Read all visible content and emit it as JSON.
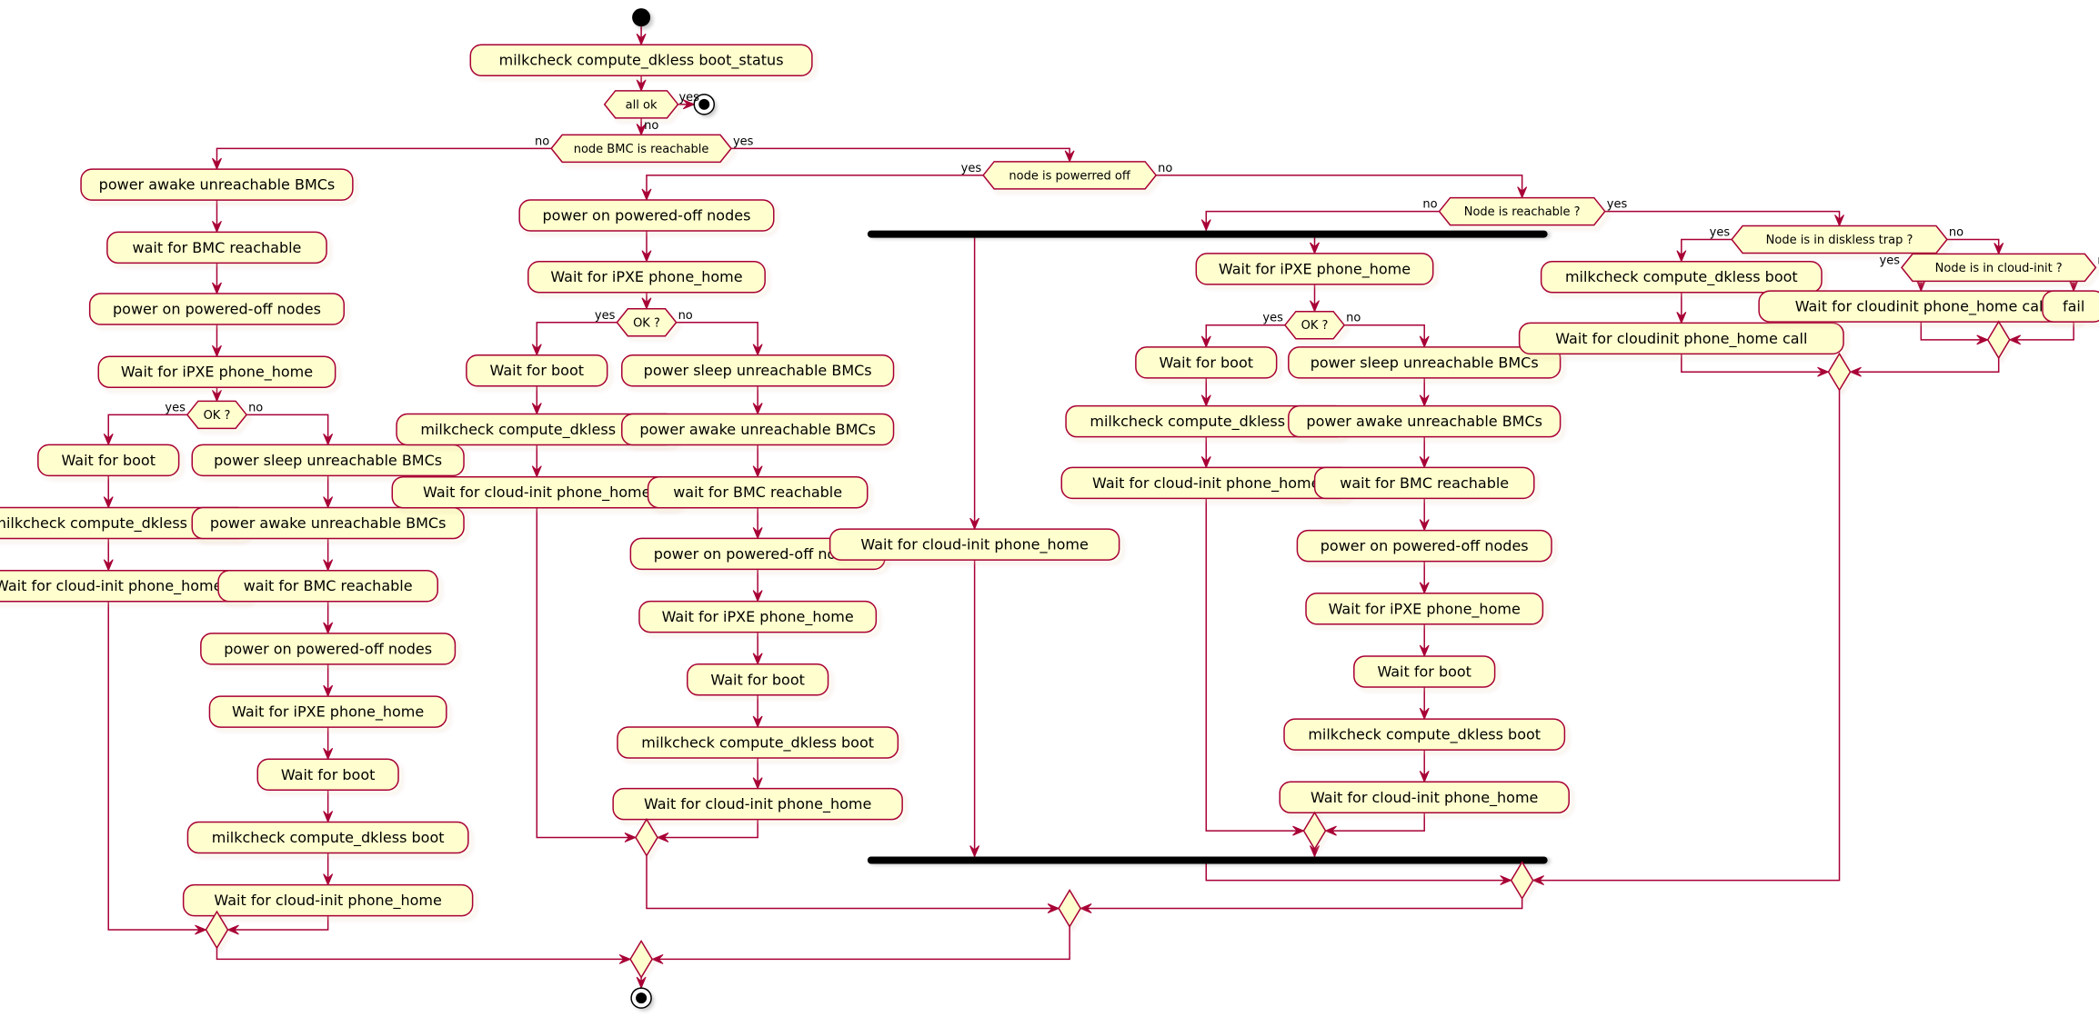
{
  "diagram": {
    "type": "activity",
    "colors": {
      "fill": "#FEFECE",
      "border": "#A80036",
      "text": "#000000",
      "bar": "#000000"
    },
    "start": "milkcheck compute_dkless boot_status",
    "nodes": {
      "boot_status": "milkcheck compute_dkless boot_status",
      "all_ok": "all ok",
      "bmc_reachable": "node BMC is reachable",
      "powered_off": "node is powerred off",
      "node_reachable": "Node is reachable ?",
      "diskless_trap": "Node is in diskless trap ?",
      "in_cloud_init": "Node is in cloud-init ?",
      "ok": "OK ?"
    },
    "labels": {
      "yes": "yes",
      "no": "no"
    },
    "branch_bmc_unreachable": {
      "pre": [
        "power awake unreachable BMCs",
        "wait for BMC reachable",
        "power on powered-off nodes",
        "Wait for iPXE phone_home"
      ],
      "ok_yes": [
        "Wait for boot",
        "milkcheck compute_dkless boot",
        "Wait for cloud-init phone_home"
      ],
      "ok_no": [
        "power sleep unreachable BMCs",
        "power awake unreachable BMCs",
        "wait for BMC reachable",
        "power on powered-off nodes",
        "Wait for iPXE phone_home",
        "Wait for boot",
        "milkcheck compute_dkless boot",
        "Wait for cloud-init phone_home"
      ]
    },
    "branch_powered_off": {
      "pre": [
        "power on powered-off nodes",
        "Wait for iPXE phone_home"
      ],
      "ok_yes": [
        "Wait for boot",
        "milkcheck compute_dkless boot",
        "Wait for cloud-init phone_home"
      ],
      "ok_no": [
        "power sleep unreachable BMCs",
        "power awake unreachable BMCs",
        "wait for BMC reachable",
        "power on powered-off nodes",
        "Wait for iPXE phone_home",
        "Wait for boot",
        "milkcheck compute_dkless boot",
        "Wait for cloud-init phone_home"
      ]
    },
    "branch_unreachable_fork": {
      "left": [
        "Wait for cloud-init phone_home"
      ],
      "pre": [
        "Wait for iPXE phone_home"
      ],
      "ok_yes": [
        "Wait for boot",
        "milkcheck compute_dkless boot",
        "Wait for cloud-init phone_home"
      ],
      "ok_no": [
        "power sleep unreachable BMCs",
        "power awake unreachable BMCs",
        "wait for BMC reachable",
        "power on powered-off nodes",
        "Wait for iPXE phone_home",
        "Wait for boot",
        "milkcheck compute_dkless boot",
        "Wait for cloud-init phone_home"
      ]
    },
    "branch_reachable": {
      "diskless_yes": [
        "milkcheck compute_dkless boot",
        "Wait for cloudinit phone_home call"
      ],
      "cloud_init_yes": [
        "Wait for cloudinit phone_home call"
      ],
      "cloud_init_no": [
        "fail"
      ]
    }
  }
}
